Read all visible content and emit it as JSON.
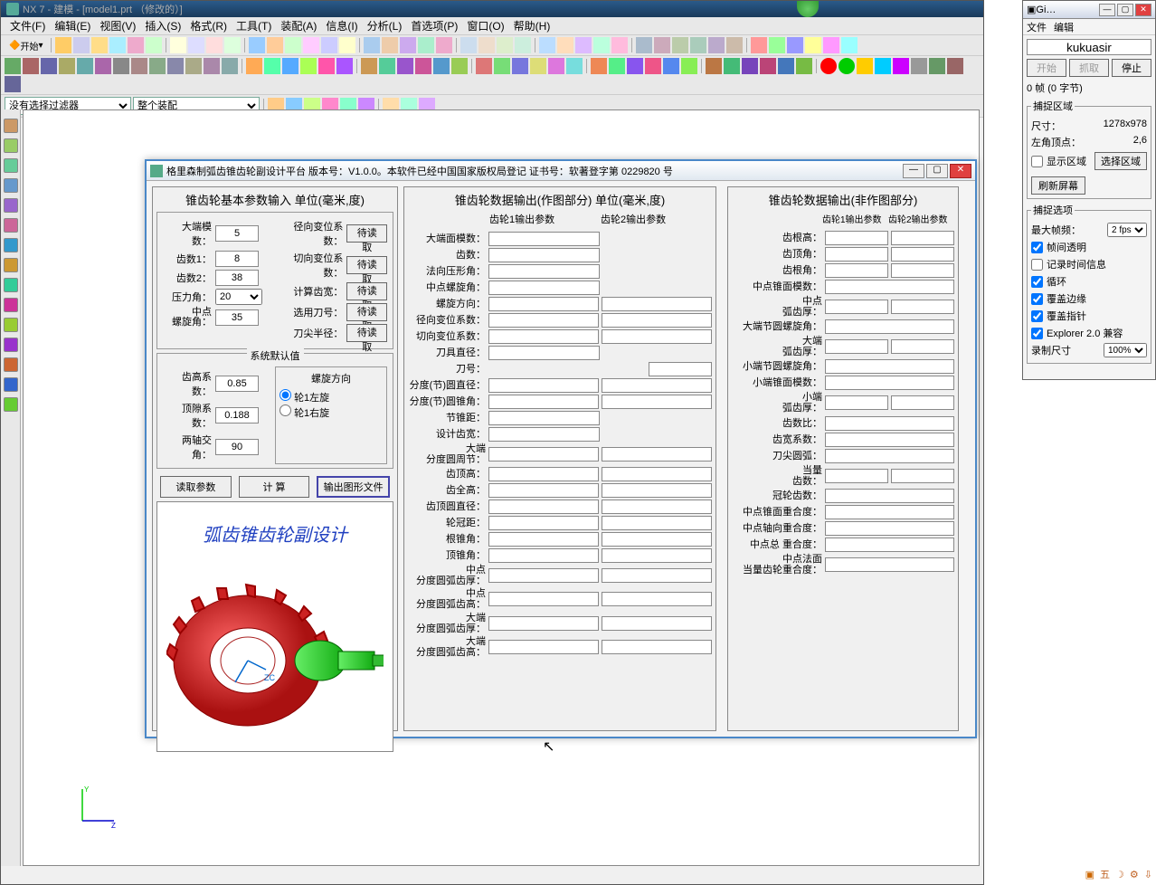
{
  "nx": {
    "title": "NX 7 - 建模 - [model1.prt （修改的）]",
    "menu": [
      "文件(F)",
      "编辑(E)",
      "视图(V)",
      "插入(S)",
      "格式(R)",
      "工具(T)",
      "装配(A)",
      "信息(I)",
      "分析(L)",
      "首选项(P)",
      "窗口(O)",
      "帮助(H)"
    ],
    "start_label": "开始",
    "filter_dropdown": "没有选择过滤器",
    "assembly_dropdown": "整个装配"
  },
  "dialog": {
    "title": "格里森制弧齿锥齿轮副设计平台 版本号：V1.0.0。本软件已经中国国家版权局登记  证书号：软著登字第 0229820 号",
    "panel1_title": "锥齿轮基本参数输入  单位(毫米,度)",
    "panel2_title": "锥齿轮数据输出(作图部分)  单位(毫米,度)",
    "panel3_title": "锥齿轮数据输出(非作图部分)",
    "inputs": {
      "large_end_module": {
        "label": "大端模数：",
        "value": "5"
      },
      "teeth1": {
        "label": "齿数1：",
        "value": "8"
      },
      "teeth2": {
        "label": "齿数2：",
        "value": "38"
      },
      "pressure_angle": {
        "label": "压力角：",
        "value": "20"
      },
      "mid_helix_angle": {
        "label": "中点\n螺旋角：",
        "value": "35"
      },
      "radial_shift": {
        "label": "径向变位系数：",
        "btn": "待读取"
      },
      "tangential_shift": {
        "label": "切向变位系数：",
        "btn": "待读取"
      },
      "calc_tooth_width": {
        "label": "计算齿宽：",
        "btn": "待读取"
      },
      "cutter_no": {
        "label": "选用刀号：",
        "btn": "待读取"
      },
      "tip_radius": {
        "label": "刀尖半径：",
        "btn": "待读取"
      }
    },
    "defaults_title": "系统默认值",
    "defaults": {
      "addendum_coef": {
        "label": "齿高系数：",
        "value": "0.85"
      },
      "clearance_coef": {
        "label": "顶隙系数：",
        "value": "0.188"
      },
      "shaft_angle": {
        "label": "两轴交角：",
        "value": "90"
      }
    },
    "helix_dir": {
      "title": "螺旋方向",
      "opt1": "轮1左旋",
      "opt2": "轮1右旋"
    },
    "buttons": {
      "read": "读取参数",
      "calc": "计  算",
      "output": "输出图形文件"
    },
    "preview_caption": "弧齿锥齿轮副设计",
    "output_headers": {
      "col1": "齿轮1输出参数",
      "col2": "齿轮2输出参数"
    },
    "out_mid": [
      "大端面模数：",
      "齿数：",
      "法向压形角：",
      "中点螺旋角：",
      "螺旋方向：",
      "径向变位系数：",
      "切向变位系数：",
      "刀具直径：",
      "刀号：",
      "分度(节)圆直径：",
      "分度(节)圆锥角：",
      "节锥距：",
      "设计齿宽：",
      "大端\n分度圆周节：",
      "齿顶高：",
      "齿全高：",
      "齿顶圆直径：",
      "轮冠距：",
      "根锥角：",
      "顶锥角：",
      "中点\n分度圆弧齿厚：",
      "中点\n分度圆弧齿高：",
      "大端\n分度圆弧齿厚：",
      "大端\n分度圆弧齿高："
    ],
    "out_right": [
      "齿根高：",
      "齿顶角：",
      "齿根角：",
      "中点锥面模数：",
      "中点\n弧齿厚：",
      "大端节圆螺旋角：",
      "大端\n弧齿厚：",
      "小端节圆螺旋角：",
      "小端锥面模数：",
      "小端\n弧齿厚：",
      "齿数比：",
      "齿宽系数：",
      "刀尖圆弧：",
      "当量\n齿数：",
      "冠轮齿数：",
      "中点锥面重合度：",
      "中点轴向重合度：",
      "中点总   重合度：",
      "中点法面\n当量齿轮重合度："
    ]
  },
  "capture": {
    "title": "Gi…",
    "menu": [
      "文件",
      "编辑"
    ],
    "name": "kukuasir",
    "btn_start": "开始",
    "btn_grab": "抓取",
    "btn_stop": "停止",
    "frame_info": "0 帧 (0 字节)",
    "region_title": "捕捉区域",
    "size_label": "尺寸：",
    "size_value": "1278x978",
    "corner_label": "左角顶点：",
    "corner_value": "2,6",
    "show_region": "显示区域",
    "select_region": "选择区域",
    "refresh": "刷新屏幕",
    "options_title": "捕捉选项",
    "max_fps_label": "最大帧频：",
    "max_fps_value": "2 fps",
    "chk_frame_trans": "帧间透明",
    "chk_record_time": "记录时间信息",
    "chk_loop": "循环",
    "chk_cover_edge": "覆盖边缘",
    "chk_cover_cursor": "覆盖指针",
    "chk_explorer": "Explorer 2.0 兼容",
    "record_size_label": "录制尺寸",
    "record_size_value": "100%"
  },
  "tray": {
    "ime": "五",
    "icons": [
      "☽",
      "⚙",
      "⇩"
    ]
  }
}
